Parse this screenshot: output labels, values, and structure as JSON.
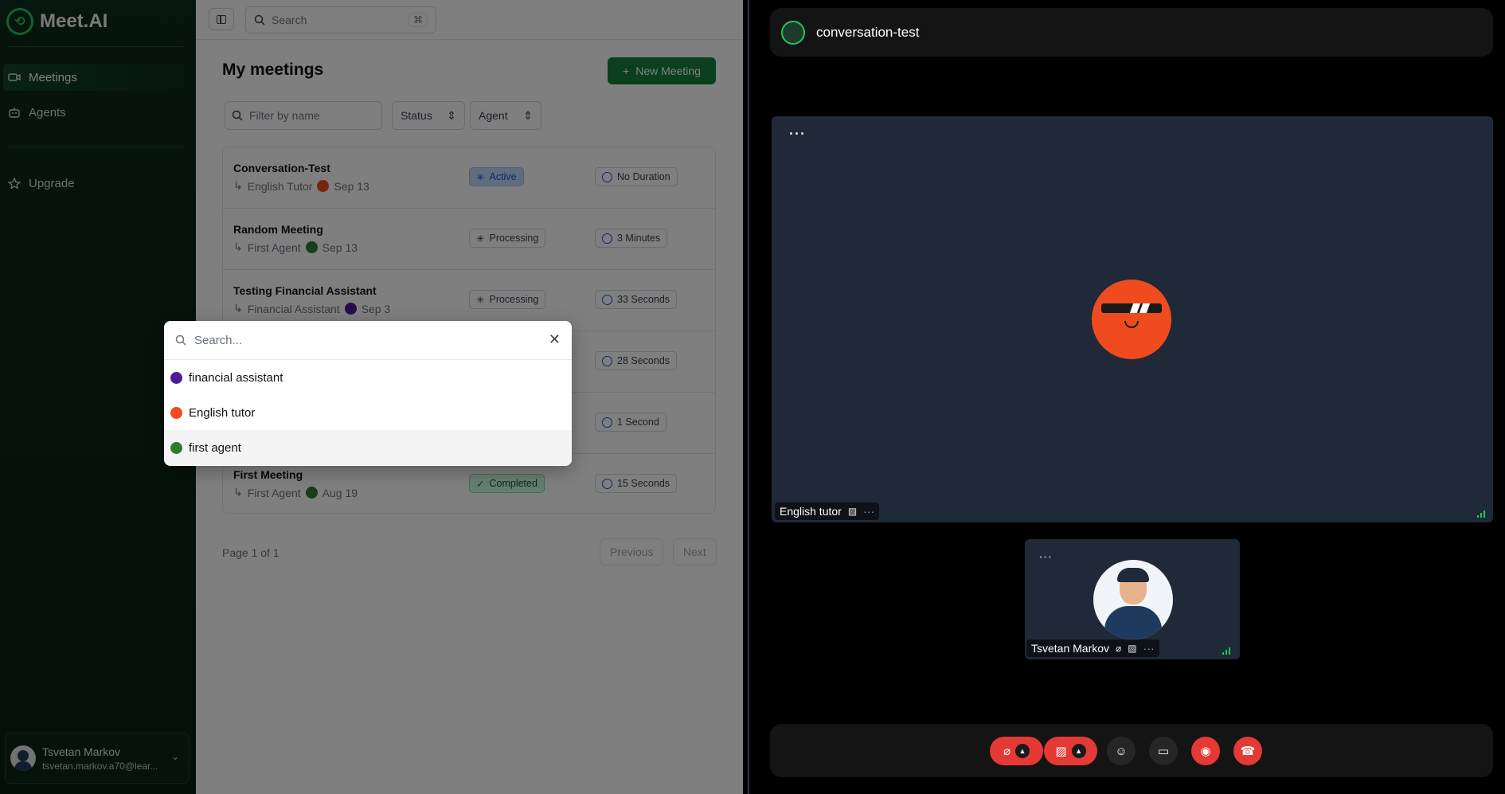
{
  "app": {
    "brand": "Meet.AI",
    "nav": [
      {
        "label": "Meetings",
        "icon": "video-icon",
        "active": true
      },
      {
        "label": "Agents",
        "icon": "bot-icon",
        "active": false
      },
      {
        "label": "Upgrade",
        "icon": "star-icon",
        "active": false
      }
    ],
    "user": {
      "name": "Tsvetan Markov",
      "email": "tsvetan.markov.a70@lear..."
    },
    "search_placeholder": "Search",
    "search_shortcut": "⌘",
    "page_title": "My meetings",
    "new_meeting_label": "New Meeting",
    "filter_placeholder": "Filter by name",
    "status_filter": "Status",
    "agent_filter": "Agent",
    "meetings": [
      {
        "title": "Conversation-Test",
        "agent": "English Tutor",
        "agent_color": "#ef4b1f",
        "date": "Sep 13",
        "status": "Active",
        "status_color": "#bfdbfe",
        "duration": "No Duration"
      },
      {
        "title": "Random Meeting",
        "agent": "First Agent",
        "agent_color": "#2e7d32",
        "date": "Sep 13",
        "status": "Processing",
        "status_color": "#f4f4f5",
        "duration": "3 Minutes"
      },
      {
        "title": "Testing Financial Assistant",
        "agent": "Financial Assistant",
        "agent_color": "#4c1d95",
        "date": "Sep 3",
        "status": "Processing",
        "status_color": "#f4f4f5",
        "duration": "33 Seconds"
      },
      {
        "title": "",
        "agent": "",
        "agent_color": "",
        "date": "",
        "status": "",
        "status_color": "",
        "duration": "28 Seconds"
      },
      {
        "title": "",
        "agent": "",
        "agent_color": "",
        "date": "",
        "status": "",
        "status_color": "",
        "duration": "1 Second"
      },
      {
        "title": "First Meeting",
        "agent": "First Agent",
        "agent_color": "#2e7d32",
        "date": "Aug 19",
        "status": "Completed",
        "status_color": "#d1fae5",
        "duration": "15 Seconds"
      }
    ],
    "pagination": {
      "text": "Page 1 of 1",
      "previous": "Previous",
      "next": "Next"
    },
    "agent_popup": {
      "placeholder": "Search...",
      "options": [
        {
          "label": "financial assistant",
          "color": "#4c1d95"
        },
        {
          "label": "English tutor",
          "color": "#ef4b1f"
        },
        {
          "label": "first agent",
          "color": "#2e7d32"
        }
      ]
    }
  },
  "call": {
    "title": "conversation-test",
    "main_participant": "English tutor",
    "self_participant": "Tsvetan Markov",
    "controls": [
      "mic-off",
      "camera-off",
      "reaction",
      "screen-share",
      "record",
      "hang-up"
    ]
  }
}
